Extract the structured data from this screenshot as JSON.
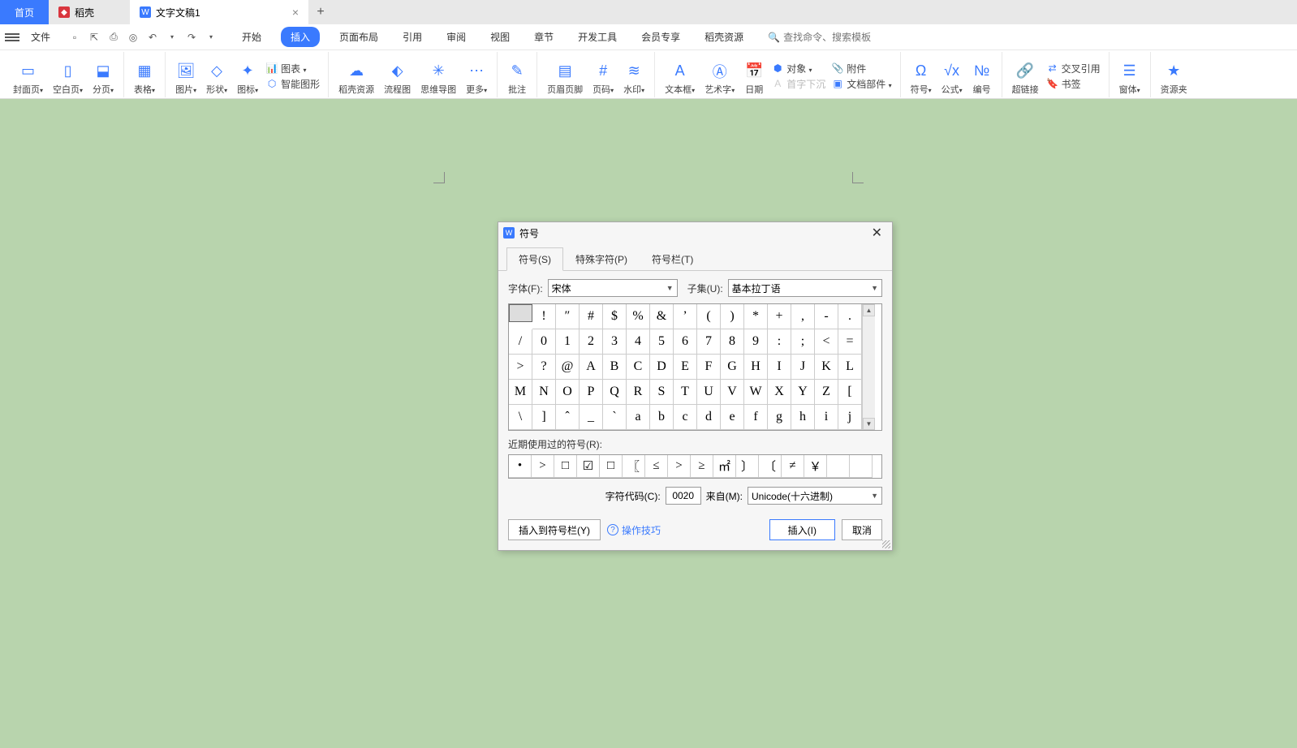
{
  "titlebar": {
    "home": "首页",
    "docshell": "稻壳",
    "doc": "文字文稿1",
    "close": "×",
    "plus": "+"
  },
  "menu": {
    "file": "文件",
    "search_ph": "查找命令、搜索模板",
    "tabs": [
      "开始",
      "插入",
      "页面布局",
      "引用",
      "审阅",
      "视图",
      "章节",
      "开发工具",
      "会员专享",
      "稻壳资源"
    ],
    "active": "插入"
  },
  "ribbon": {
    "g1": [
      {
        "l": "封面页",
        "d": 1
      },
      {
        "l": "空白页",
        "d": 1
      },
      {
        "l": "分页",
        "d": 1
      }
    ],
    "g2": [
      {
        "l": "表格",
        "d": 1
      }
    ],
    "g3": [
      {
        "l": "图片",
        "d": 1
      },
      {
        "l": "形状",
        "d": 1
      },
      {
        "l": "图标",
        "d": 1
      }
    ],
    "g3s": [
      {
        "l": "图表",
        "d": 1
      },
      {
        "l": "智能图形"
      }
    ],
    "g4": [
      {
        "l": "稻壳资源"
      },
      {
        "l": "流程图"
      },
      {
        "l": "思维导图"
      },
      {
        "l": "更多",
        "d": 1
      }
    ],
    "g5": [
      {
        "l": "批注"
      }
    ],
    "g6": [
      {
        "l": "页眉页脚"
      },
      {
        "l": "页码",
        "d": 1
      },
      {
        "l": "水印",
        "d": 1
      }
    ],
    "g7": [
      {
        "l": "文本框",
        "d": 1
      },
      {
        "l": "艺术字",
        "d": 1
      },
      {
        "l": "日期"
      }
    ],
    "g7s": [
      {
        "l": "对象",
        "d": 1
      },
      {
        "l": "附件"
      },
      {
        "l": "文档部件",
        "d": 1
      }
    ],
    "g7s2": [
      {
        "l": "首字下沉",
        "dis": 1
      }
    ],
    "g8": [
      {
        "l": "符号",
        "d": 1
      },
      {
        "l": "公式",
        "d": 1
      },
      {
        "l": "编号"
      }
    ],
    "g9": [
      {
        "l": "超链接"
      }
    ],
    "g9s": [
      {
        "l": "交叉引用"
      },
      {
        "l": "书签"
      }
    ],
    "g10": [
      {
        "l": "窗体",
        "d": 1
      }
    ],
    "g11": [
      {
        "l": "资源夹"
      }
    ]
  },
  "dialog": {
    "title": "符号",
    "tabs": [
      "符号(S)",
      "特殊字符(P)",
      "符号栏(T)"
    ],
    "font_label": "字体(F):",
    "font_val": "宋体",
    "subset_label": "子集(U):",
    "subset_val": "基本拉丁语",
    "grid": [
      [
        " ",
        "!",
        "″",
        "#",
        "$",
        "%",
        "&",
        "’",
        "(",
        ")",
        "*",
        "+",
        ",",
        "-",
        "."
      ],
      [
        "/",
        "0",
        "1",
        "2",
        "3",
        "4",
        "5",
        "6",
        "7",
        "8",
        "9",
        ":",
        ";",
        "<",
        "="
      ],
      [
        ">",
        "?",
        "@",
        "A",
        "B",
        "C",
        "D",
        "E",
        "F",
        "G",
        "H",
        "I",
        "J",
        "K",
        "L"
      ],
      [
        "M",
        "N",
        "O",
        "P",
        "Q",
        "R",
        "S",
        "T",
        "U",
        "V",
        "W",
        "X",
        "Y",
        "Z",
        "["
      ],
      [
        "\\",
        "]",
        "ˆ",
        "_",
        "`",
        "a",
        "b",
        "c",
        "d",
        "e",
        "f",
        "g",
        "h",
        "i",
        "j"
      ]
    ],
    "recent_label": "近期使用过的符号(R):",
    "recent": [
      "•",
      ">",
      "□",
      "☑",
      "□",
      "〖",
      "≤",
      ">",
      "≥",
      "㎡",
      "〕",
      "〔",
      "≠",
      "￥",
      "",
      ""
    ],
    "code_label": "字符代码(C):",
    "code_val": "0020",
    "from_label": "来自(M):",
    "from_val": "Unicode(十六进制)",
    "insert_bar": "插入到符号栏(Y)",
    "tips": "操作技巧",
    "insert": "插入(I)",
    "cancel": "取消"
  }
}
